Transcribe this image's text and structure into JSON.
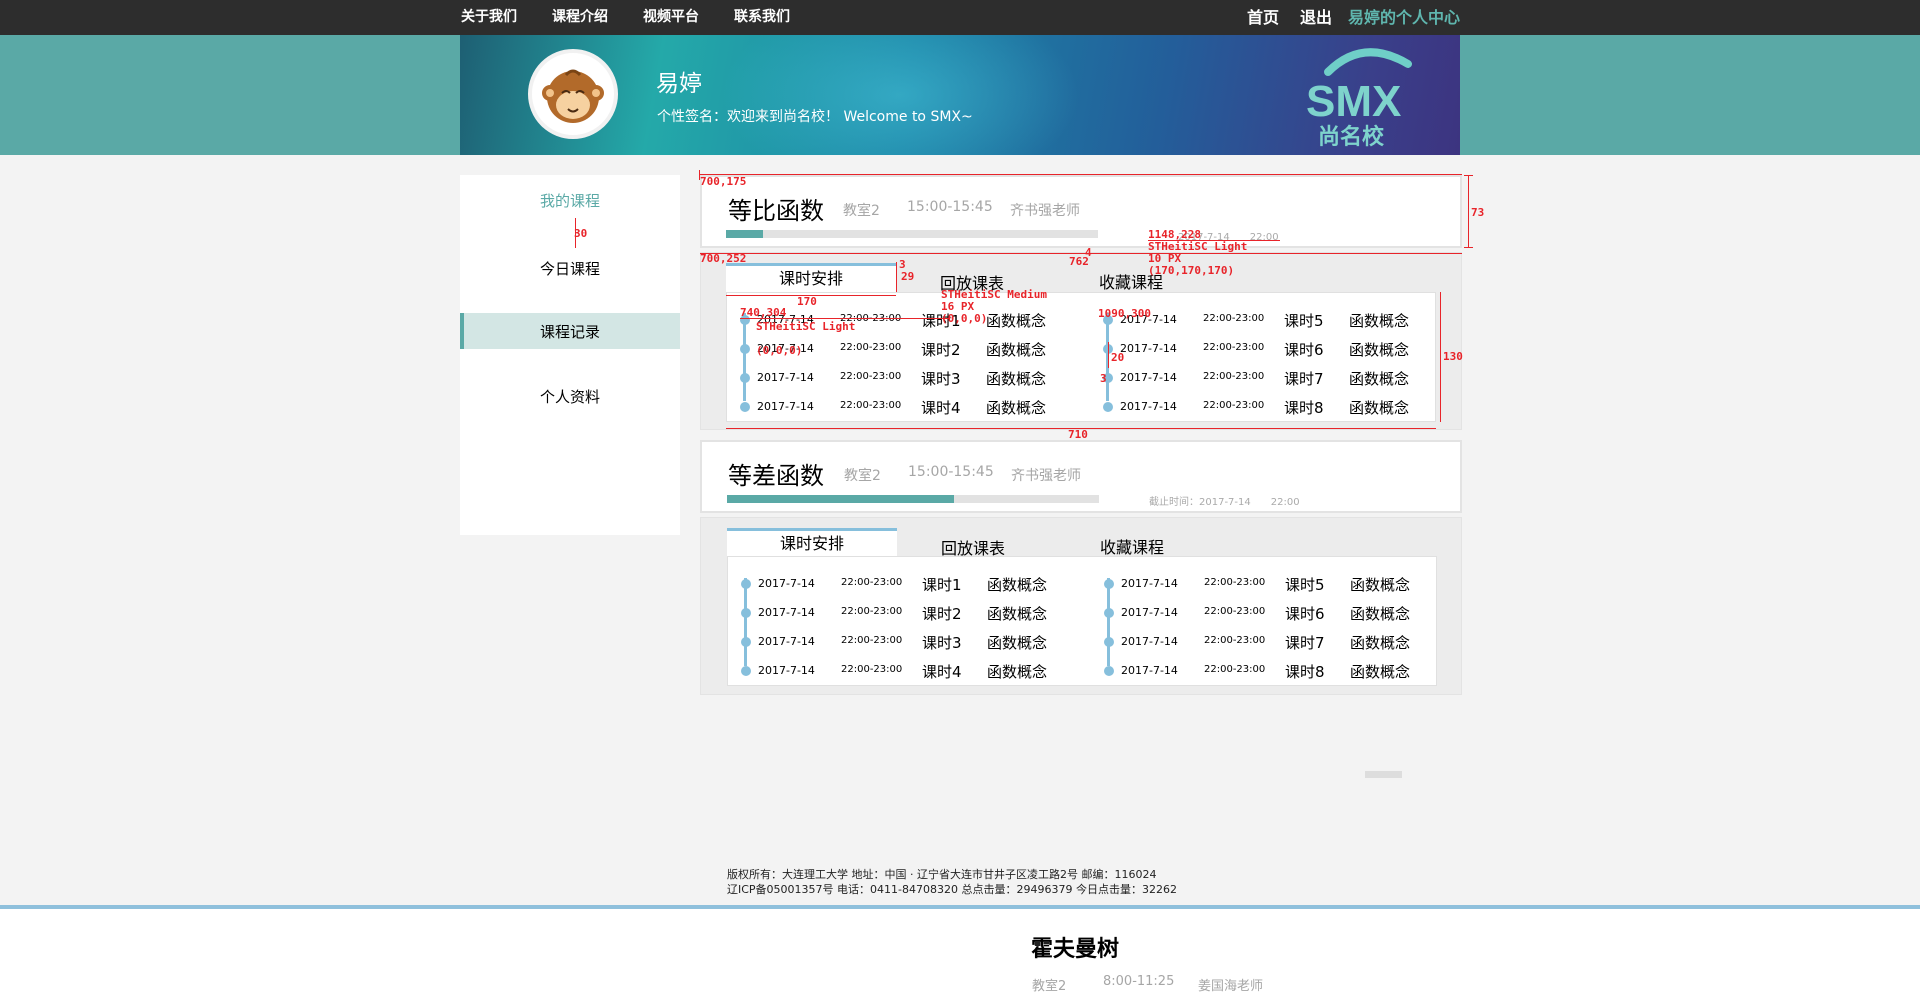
{
  "nav": {
    "left": [
      "关于我们",
      "课程介绍",
      "视频平台",
      "联系我们"
    ],
    "home": "首页",
    "logout": "退出",
    "center": "易婷的个人中心"
  },
  "banner": {
    "username": "易婷",
    "signature": "个性签名：欢迎来到尚名校！ Welcome to SMX~",
    "logo_text": "SMX",
    "logo_cn": "尚名校"
  },
  "sidebar": {
    "items": [
      "我的课程",
      "今日课程",
      "课程记录",
      "个人资料"
    ],
    "active": "课程记录"
  },
  "courses": [
    {
      "title": "等比函数",
      "room": "教室2",
      "time": "15:00-15:45",
      "teacher": "齐书强老师",
      "deadline": "2017-7-14　　22:00",
      "progress": 0.1,
      "tabs": [
        "课时安排",
        "回放课表",
        "收藏课程"
      ],
      "left": [
        {
          "date": "2017-7-14",
          "time": "22:00-23:00",
          "lesson": "课时1",
          "topic": "函数概念"
        },
        {
          "date": "2017-7-14",
          "time": "22:00-23:00",
          "lesson": "课时2",
          "topic": "函数概念"
        },
        {
          "date": "2017-7-14",
          "time": "22:00-23:00",
          "lesson": "课时3",
          "topic": "函数概念"
        },
        {
          "date": "2017-7-14",
          "time": "22:00-23:00",
          "lesson": "课时4",
          "topic": "函数概念"
        }
      ],
      "right": [
        {
          "date": "2017-7-14",
          "time": "22:00-23:00",
          "lesson": "课时5",
          "topic": "函数概念"
        },
        {
          "date": "2017-7-14",
          "time": "22:00-23:00",
          "lesson": "课时6",
          "topic": "函数概念"
        },
        {
          "date": "2017-7-14",
          "time": "22:00-23:00",
          "lesson": "课时7",
          "topic": "函数概念"
        },
        {
          "date": "2017-7-14",
          "time": "22:00-23:00",
          "lesson": "课时8",
          "topic": "函数概念"
        }
      ]
    },
    {
      "title": "等差函数",
      "room": "教室2",
      "time": "15:00-15:45",
      "teacher": "齐书强老师",
      "deadline": "截止时间：2017-7-14　　22:00",
      "progress": 0.61,
      "tabs": [
        "课时安排",
        "回放课表",
        "收藏课程"
      ],
      "left": [
        {
          "date": "2017-7-14",
          "time": "22:00-23:00",
          "lesson": "课时1",
          "topic": "函数概念"
        },
        {
          "date": "2017-7-14",
          "time": "22:00-23:00",
          "lesson": "课时2",
          "topic": "函数概念"
        },
        {
          "date": "2017-7-14",
          "time": "22:00-23:00",
          "lesson": "课时3",
          "topic": "函数概念"
        },
        {
          "date": "2017-7-14",
          "time": "22:00-23:00",
          "lesson": "课时4",
          "topic": "函数概念"
        }
      ],
      "right": [
        {
          "date": "2017-7-14",
          "time": "22:00-23:00",
          "lesson": "课时5",
          "topic": "函数概念"
        },
        {
          "date": "2017-7-14",
          "time": "22:00-23:00",
          "lesson": "课时6",
          "topic": "函数概念"
        },
        {
          "date": "2017-7-14",
          "time": "22:00-23:00",
          "lesson": "课时7",
          "topic": "函数概念"
        },
        {
          "date": "2017-7-14",
          "time": "22:00-23:00",
          "lesson": "课时8",
          "topic": "函数概念"
        }
      ]
    }
  ],
  "annotations": {
    "c1": "700,175",
    "c2": "700,252",
    "c3": "1148,228",
    "c4": "740,304",
    "c5": "1090,300",
    "f1": "STHeitiSC Light",
    "f1_size": "10 PX",
    "f1_color": "(170,170,170)",
    "f2": "STHeitiSC Medium",
    "f2_size": "16 PX",
    "f2_color": "(0,0,0)",
    "f3": "STHeitiSC Light",
    "f3_color": "(0,0,0)",
    "d30": "30",
    "d73": "73",
    "d4": "4",
    "d762": "762",
    "d3": "3",
    "d29": "29",
    "d170": "170",
    "d130": "130",
    "d20": "20",
    "d3b": "3",
    "d710": "710"
  },
  "footer": {
    "line1": "版权所有：大连理工大学  地址：中国 · 辽宁省大连市甘井子区凌工路2号  邮编：116024",
    "line2": "辽ICP备05001357号  电话：0411-84708320 总点击量：29496379 今日点击量：32262"
  },
  "next_course": {
    "title": "霍夫曼树",
    "room": "教室2",
    "time": "8:00-11:25",
    "teacher": "姜国海老师"
  }
}
